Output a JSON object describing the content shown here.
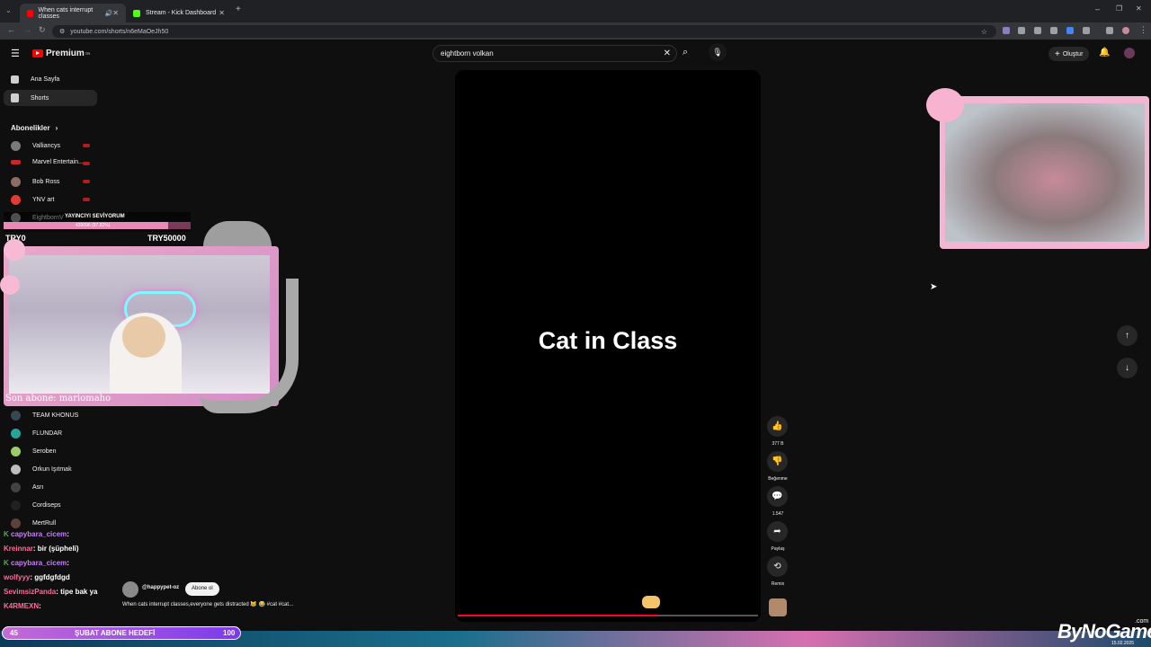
{
  "browser": {
    "tabs": [
      {
        "title": "When cats interrupt classes",
        "active": true
      },
      {
        "title": "Stream - Kick Dashboard",
        "active": false
      }
    ],
    "new_tab": "+",
    "url": "youtube.com/shorts/n6eMaOeJh50"
  },
  "youtube": {
    "logo": "Premium",
    "logo_sup": "TR",
    "search_value": "eightborn volkan",
    "create_label": "Oluştur",
    "nav": [
      {
        "label": "Ana Sayfa",
        "icon": "home-icon"
      },
      {
        "label": "Shorts",
        "icon": "shorts-icon"
      }
    ],
    "subscriptions_heading": "Abonelikler",
    "subscriptions_top": [
      "Valliancys",
      "Marvel Entertain...",
      "Bob Ross",
      "YNV art",
      "EightbornV"
    ],
    "subscriptions_bottom": [
      "TEAM KHONUS",
      "FLUNDAR",
      "Seroben",
      "Orkun Işıtmak",
      "Asrı",
      "Cordiseps",
      "MertRull"
    ],
    "short": {
      "title": "Cat in Class",
      "channel": "@happypet-oz",
      "subscribe": "Abone ol",
      "description": "When cats interrupt classes,everyone gets distracted 😹 😂 #cat #cat..."
    },
    "actions": [
      {
        "icon": "like-icon",
        "label": "377 B"
      },
      {
        "icon": "dislike-icon",
        "label": "Beğenme"
      },
      {
        "icon": "comment-icon",
        "label": "1.547"
      },
      {
        "icon": "share-icon",
        "label": "Paylaş"
      },
      {
        "icon": "remix-icon",
        "label": "Remix"
      }
    ]
  },
  "overlay": {
    "top_banner": "YAYINCIYI SEVİYORUM",
    "progress_text": "439096 (87.82%)",
    "progress_fraction": 0.8782,
    "goal_left": "TRY0",
    "goal_right": "TRY50000",
    "last_sub": "Son abone: mariomaho",
    "chat": [
      {
        "user": "capybara_cicem",
        "text": ":",
        "color": "#c77dff"
      },
      {
        "user": "Kreinnar",
        "text": ": bir (şüpheli)",
        "color": "#ff6b9d"
      },
      {
        "user": "capybara_cicem",
        "text": ":",
        "color": "#c77dff"
      },
      {
        "user": "wolfyyy",
        "text": ": ggfdgfdgd",
        "color": "#ff6b9d"
      },
      {
        "user": "SevimsizPanda",
        "text": ": tipe bak ya",
        "color": "#ff6b9d"
      },
      {
        "user": "K4RMEXN",
        "text": ":",
        "color": "#ff6b9d"
      }
    ],
    "goal_bar": {
      "left": "45",
      "label": "ŞUBAT ABONE HEDEFİ",
      "right": "100"
    },
    "brand": "ByNoGame",
    "brand_sup": ".com",
    "date": "15.02.2025"
  }
}
